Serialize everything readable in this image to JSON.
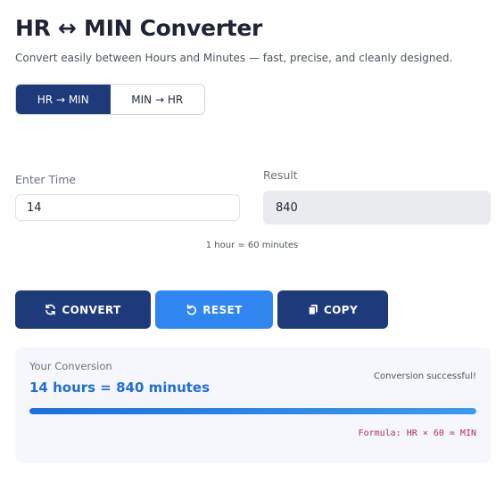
{
  "header": {
    "title": "HR ↔ MIN Converter",
    "subtitle": "Convert easily between Hours and Minutes — fast, precise, and cleanly designed."
  },
  "mode_toggle": {
    "options": [
      {
        "label": "HR → MIN",
        "active": true
      },
      {
        "label": "MIN → HR",
        "active": false
      }
    ]
  },
  "form": {
    "input_label": "Enter Time",
    "input_value": "14",
    "result_label": "Result",
    "result_value": "840",
    "hint": "1 hour = 60 minutes"
  },
  "actions": {
    "convert_label": "CONVERT",
    "reset_label": "RESET",
    "copy_label": "COPY",
    "convert_icon": "refresh-icon",
    "reset_icon": "undo-icon",
    "copy_icon": "clipboard-icon"
  },
  "summary": {
    "label": "Your Conversion",
    "result_text": "14 hours = 840 minutes",
    "status": "Conversion successful!",
    "progress": 1.0,
    "formula": "Formula: HR × 60 = MIN"
  },
  "colors": {
    "primary": "#1e3a7b",
    "accent": "#2f86f0",
    "result_text": "#1f6fd6",
    "formula_text": "#b0306a"
  }
}
